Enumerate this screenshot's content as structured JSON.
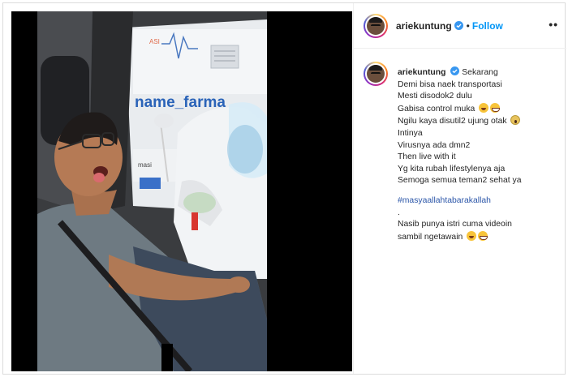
{
  "post": {
    "username": "ariekuntung",
    "follow_label": "Follow",
    "separator": "•",
    "more_label": "••",
    "caption": {
      "lines": [
        "Sekarang",
        "Demi bisa naek transportasi",
        "Mesti disodok2 dulu",
        "Gabisa control muka",
        "Ngilu kaya disutil2 ujung otak",
        "Intinya",
        "Virusnya ada dmn2",
        "Then live with it",
        "Yg kita rubah lifestylenya aja",
        "Semoga semua teman2 sehat ya"
      ],
      "hashtag": "#masyaallahtabarakallah",
      "dot": ".",
      "closing_lines": [
        "Nasib punya istri cuma videoin",
        "sambil ngetawain"
      ]
    },
    "media": {
      "sign_text": "name_farma",
      "sign_small": "masi",
      "sign_top": "ASI"
    }
  },
  "colors": {
    "follow_blue": "#0095f6",
    "verified_blue": "#3897f0",
    "hashtag_blue": "#2a55a8",
    "text": "#262626"
  },
  "icons": [
    "verified-badge-icon",
    "more-options-icon",
    "laughing-emoji-icon",
    "grinning-emoji-icon",
    "screaming-emoji-icon"
  ]
}
